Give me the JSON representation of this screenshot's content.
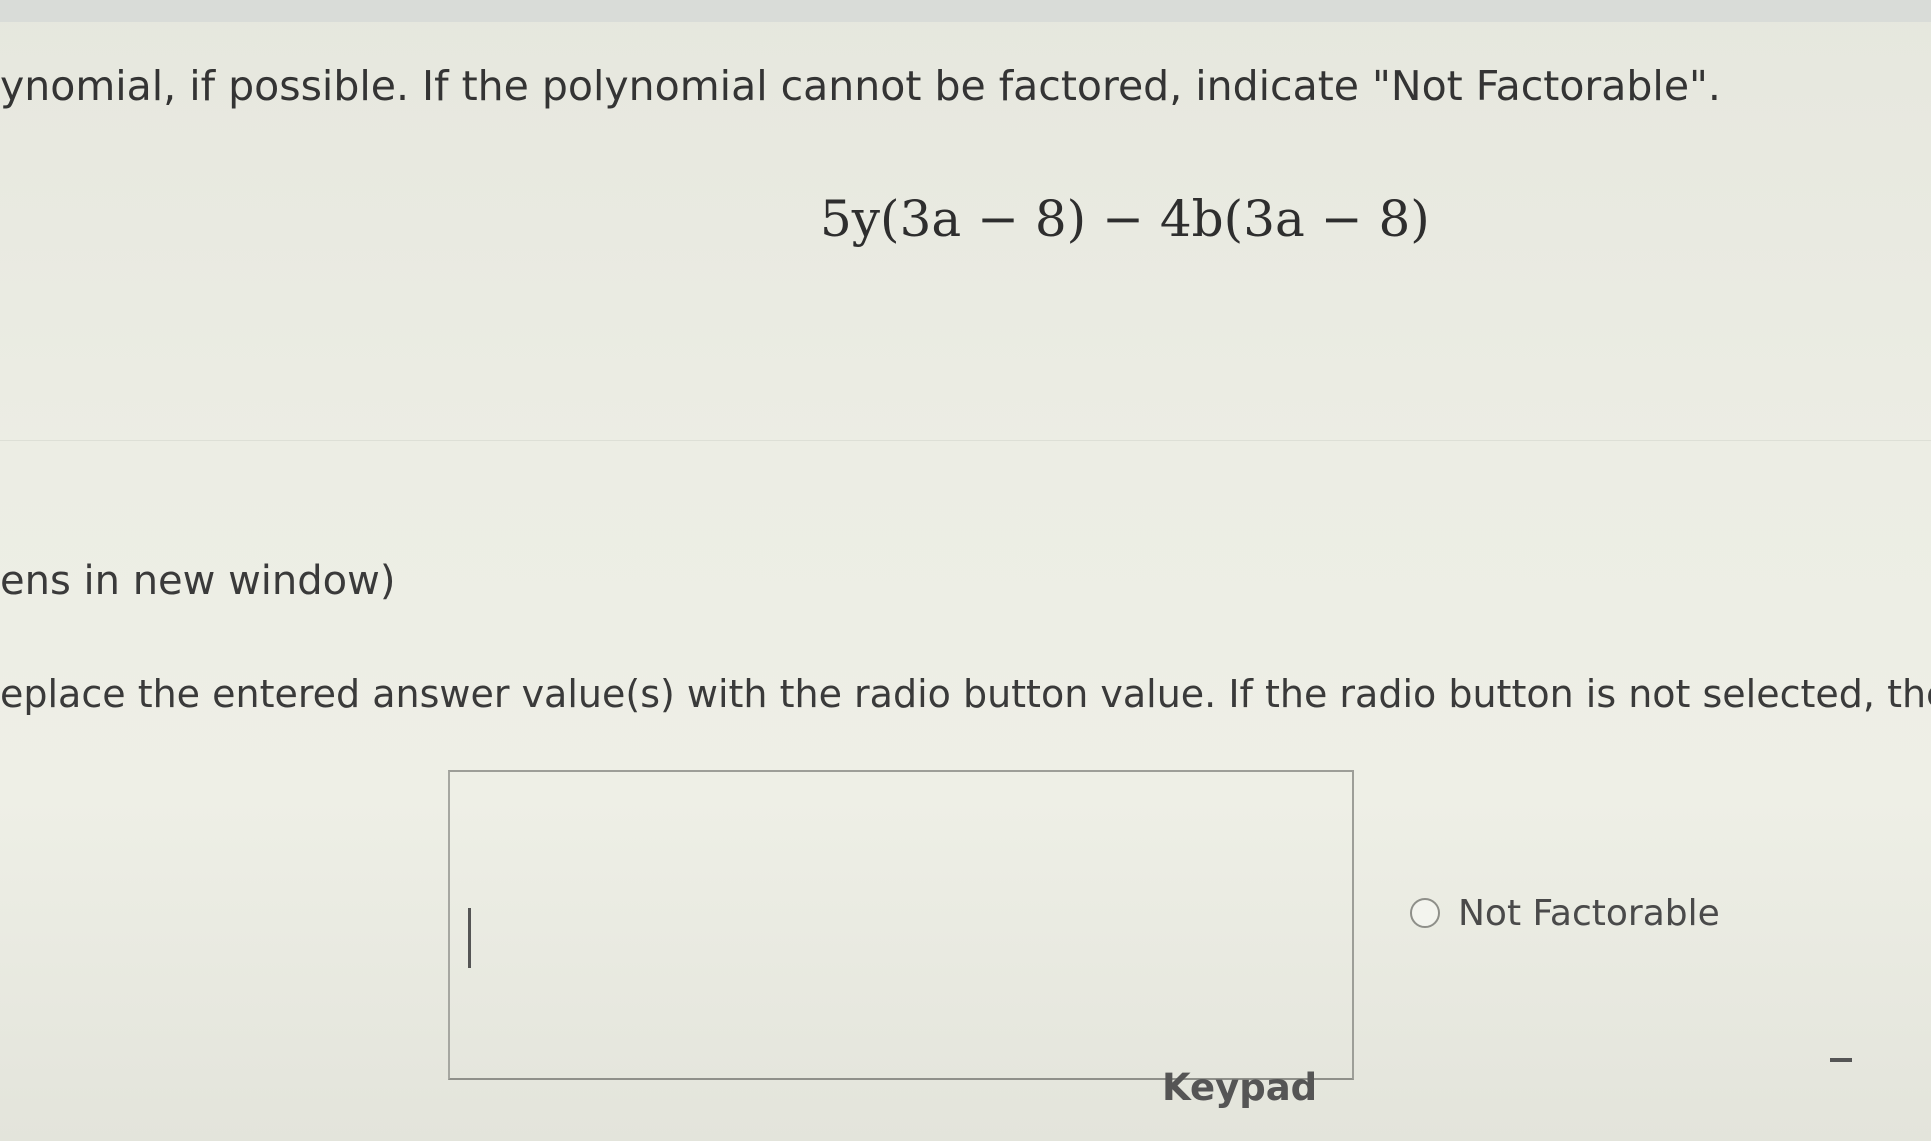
{
  "question": {
    "instruction": "ynomial, if possible. If the polynomial cannot be factored, indicate \"Not Factorable\".",
    "expression": "5y(3a − 8) − 4b(3a − 8)"
  },
  "help": {
    "link_text": "ens in new window)"
  },
  "answer": {
    "note": "eplace the entered answer value(s) with the radio button value. If the radio button is not selected, the",
    "input_value": "",
    "not_factorable_label": "Not Factorable",
    "keypad_label": "Keypad"
  }
}
